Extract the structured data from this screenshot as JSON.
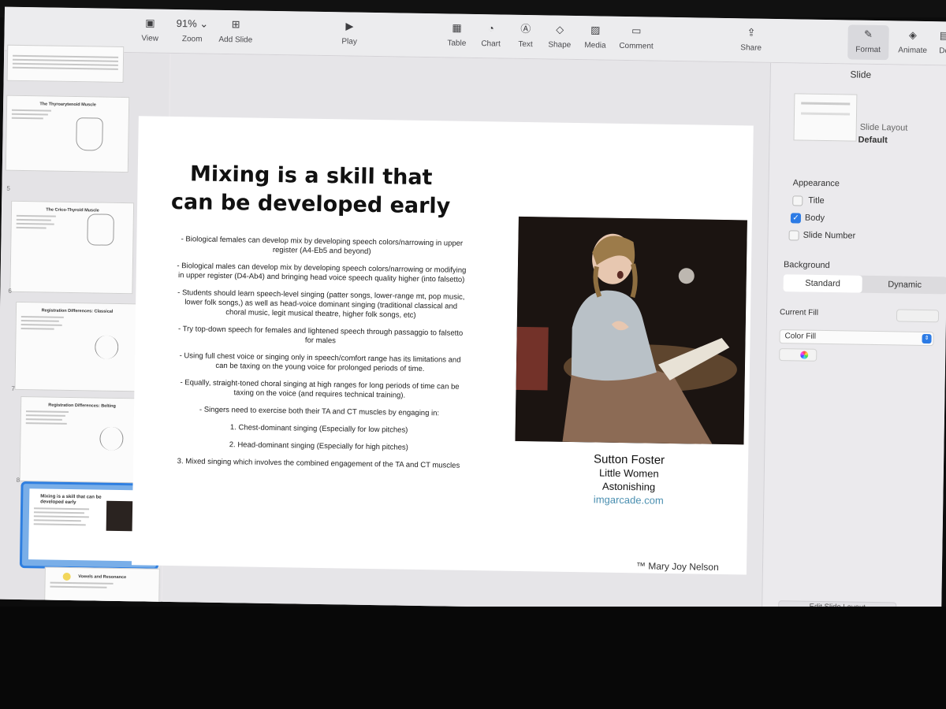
{
  "toolbar": {
    "view": "View",
    "zoom_value": "91%",
    "zoom": "Zoom",
    "add_slide": "Add Slide",
    "play": "Play",
    "table": "Table",
    "chart": "Chart",
    "text": "Text",
    "shape": "Shape",
    "media": "Media",
    "comment": "Comment",
    "share": "Share",
    "format": "Format",
    "animate": "Animate",
    "document": "Do"
  },
  "navigator": {
    "slides": [
      {
        "title": "The Thyroarytenoid Muscle"
      },
      {
        "title": "The Crico-Thyroid Muscle"
      },
      {
        "title": "Registration Differences: Classical"
      },
      {
        "title": "Registration Differences: Belting"
      },
      {
        "title": "Mixing is a skill that can be developed early"
      },
      {
        "title": "Vowels and Resonance"
      }
    ],
    "numbers": [
      "5",
      "6",
      "7",
      "8"
    ]
  },
  "slide": {
    "title": "Mixing is a skill that can be developed early",
    "bullets": [
      "- Biological females can develop mix by developing speech colors/narrowing in upper register (A4-Eb5 and beyond)",
      "- Biological males can develop mix by developing speech colors/narrowing or modifying in upper register (D4-Ab4) and bringing head voice speech quality higher (into falsetto)",
      "- Students should learn speech-level singing (patter songs, lower-range mt, pop music, lower folk songs,) as well as head-voice dominant singing (traditional classical and choral music, legit musical theatre, higher folk songs, etc)",
      "- Try top-down speech for females and lightened speech through passaggio to falsetto for males",
      "- Using full chest voice or singing only in speech/comfort range has its limitations and can be taxing on the young voice for prolonged periods of time.",
      "- Equally, straight-toned choral singing at high ranges for long periods of time can be taxing on the voice (and requires technical training).",
      "- Singers need to exercise both their TA and CT muscles by engaging in:",
      "1. Chest-dominant singing (Especially for low pitches)",
      "2. Head-dominant singing (Especially for high pitches)",
      "3. Mixed singing which involves the combined engagement of the TA and CT muscles"
    ],
    "caption_name": "Sutton Foster",
    "caption_line1": "Little Women",
    "caption_line2": "Astonishing",
    "caption_link": "imgarcade.com",
    "trademark": "™ Mary Joy Nelson"
  },
  "inspector": {
    "header": "Slide",
    "layout_label": "Slide Layout",
    "layout_value": "Default",
    "appearance": "Appearance",
    "title": "Title",
    "body": "Body",
    "slide_number": "Slide Number",
    "background": "Background",
    "standard": "Standard",
    "dynamic": "Dynamic",
    "current_fill": "Current Fill",
    "color_fill": "Color Fill",
    "edit_layout": "Edit Slide Layout"
  }
}
